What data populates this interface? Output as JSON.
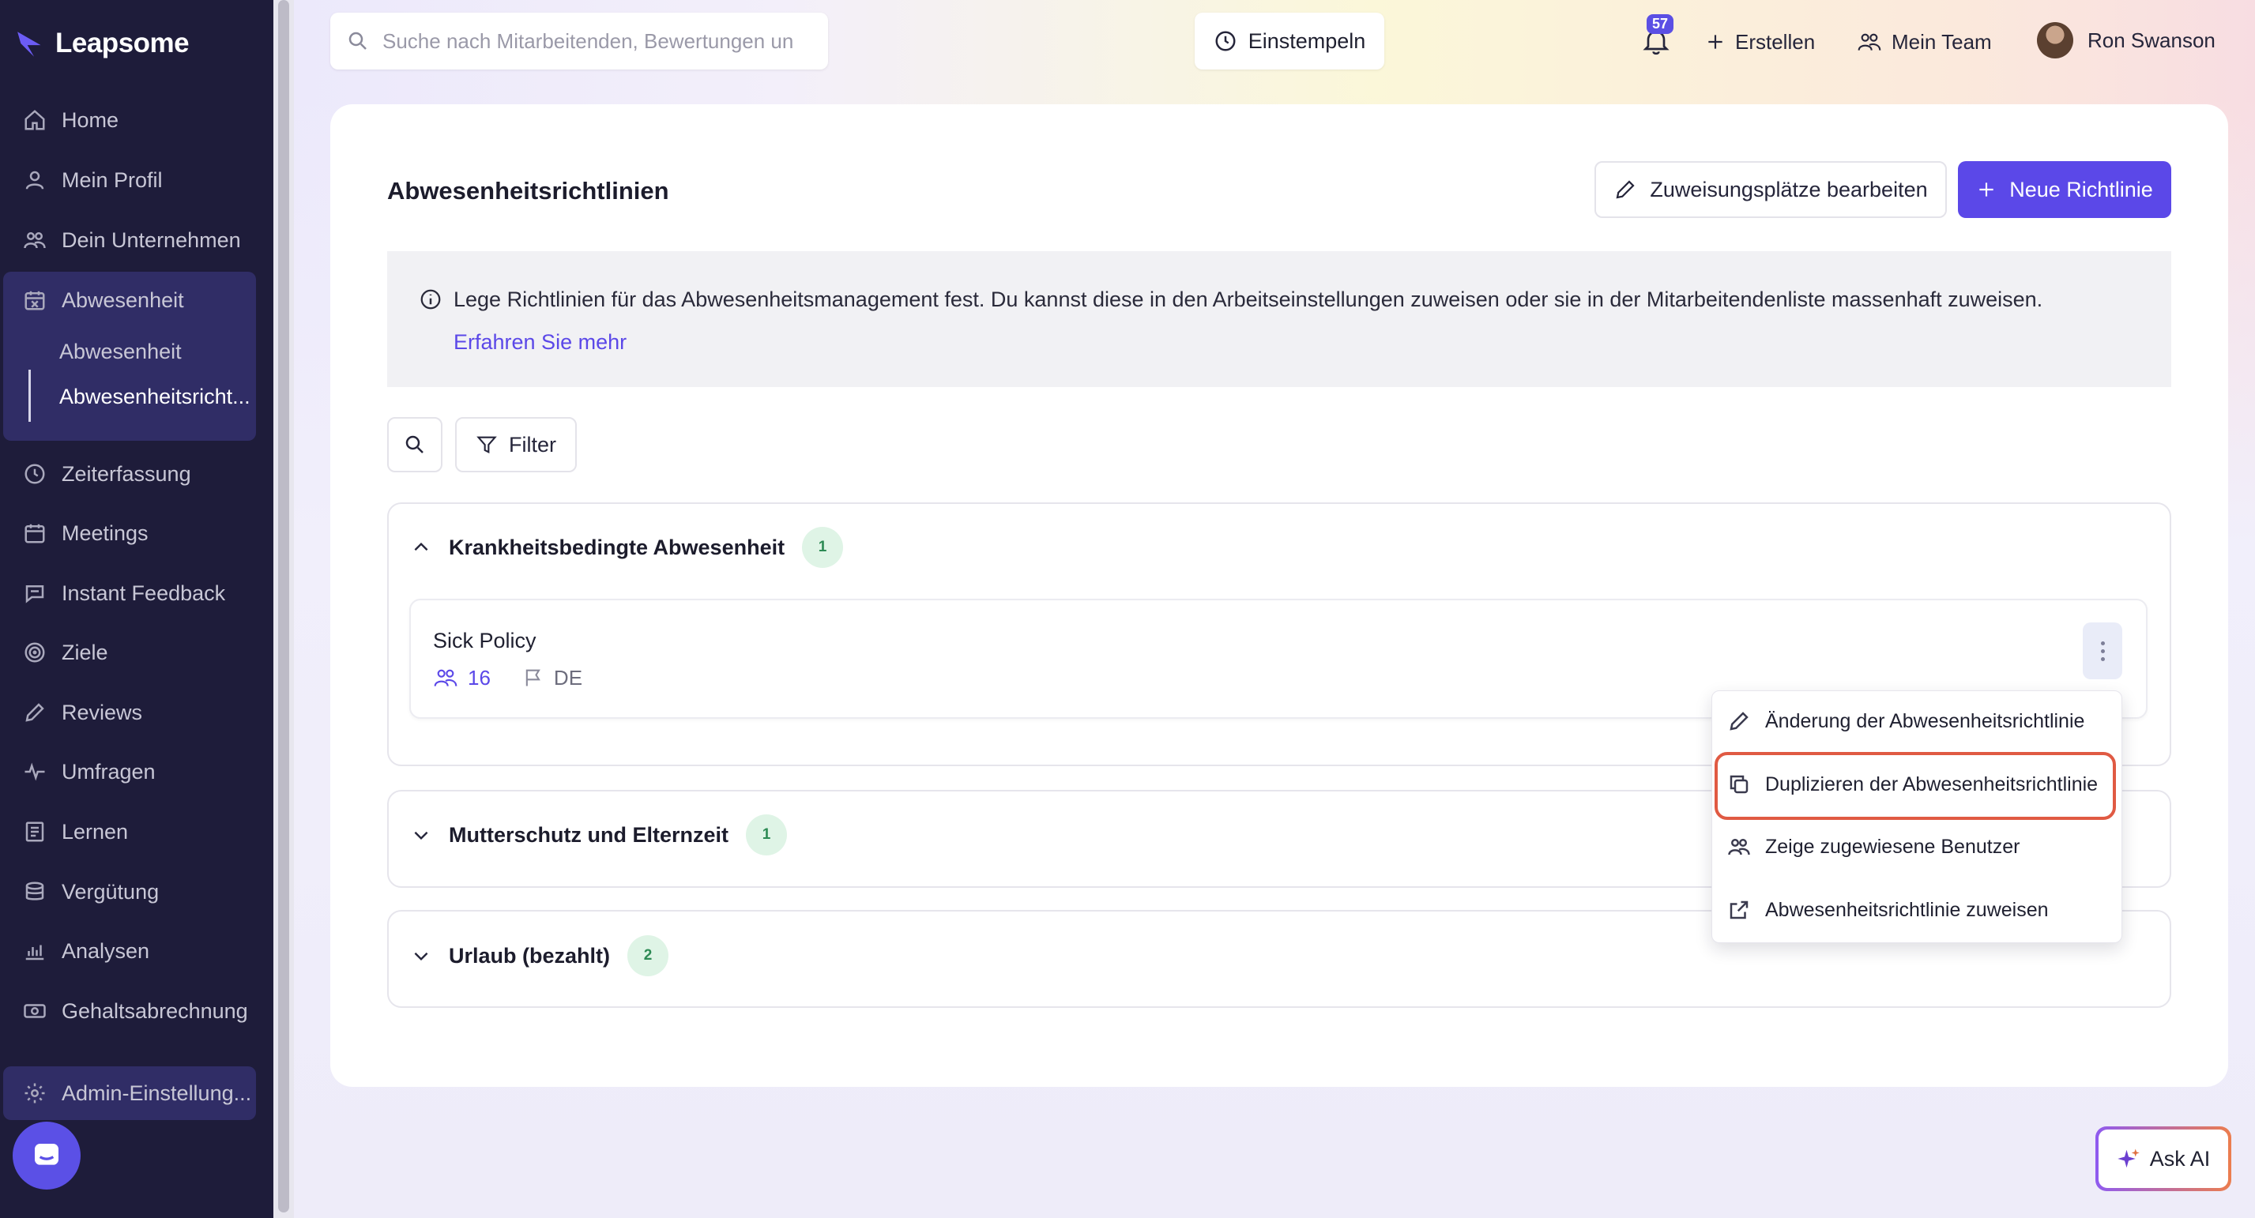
{
  "app": {
    "brand": "Leapsome"
  },
  "colors": {
    "accent": "#5b48e8",
    "sidebar": "#1e1c3a",
    "badge_green": "#dff4e6",
    "highlight": "#e05a43"
  },
  "sidebar": {
    "items": [
      {
        "label": "Home",
        "icon": "home-icon"
      },
      {
        "label": "Mein Profil",
        "icon": "user-icon"
      },
      {
        "label": "Dein Unternehmen",
        "icon": "users-icon"
      },
      {
        "label": "Abwesenheit",
        "icon": "calendar-x-icon"
      },
      {
        "label": "Zeiterfassung",
        "icon": "clock-icon"
      },
      {
        "label": "Meetings",
        "icon": "calendar-icon"
      },
      {
        "label": "Instant Feedback",
        "icon": "chat-icon"
      },
      {
        "label": "Ziele",
        "icon": "target-icon"
      },
      {
        "label": "Reviews",
        "icon": "pencil-icon"
      },
      {
        "label": "Umfragen",
        "icon": "pulse-icon"
      },
      {
        "label": "Lernen",
        "icon": "book-icon"
      },
      {
        "label": "Vergütung",
        "icon": "coins-icon"
      },
      {
        "label": "Analysen",
        "icon": "chart-icon"
      },
      {
        "label": "Gehaltsabrechnung",
        "icon": "money-icon"
      },
      {
        "label": "Admin-Einstellung...",
        "icon": "gear-icon"
      }
    ],
    "sub_items": [
      "Abwesenheit",
      "Abwesenheitsricht..."
    ]
  },
  "topbar": {
    "search_placeholder": "Suche nach Mitarbeitenden, Bewertungen un",
    "clock_in": "Einstempeln",
    "notification_count": "57",
    "create": "Erstellen",
    "my_team": "Mein Team",
    "user_name": "Ron Swanson"
  },
  "page": {
    "title": "Abwesenheitsrichtlinien",
    "edit_assignments": "Zuweisungsplätze bearbeiten",
    "new_policy": "Neue Richtlinie",
    "info_text": "Lege Richtlinien für das Abwesenheitsmanagement fest. Du kannst diese in den Arbeitseinstellungen zuweisen oder sie in der Mitarbeitendenliste massenhaft zuweisen.",
    "info_link": "Erfahren Sie mehr",
    "filter": "Filter"
  },
  "sections": [
    {
      "title": "Krankheitsbedingte Abwesenheit",
      "count": "1",
      "expanded": true
    },
    {
      "title": "Mutterschutz und Elternzeit",
      "count": "1",
      "expanded": false
    },
    {
      "title": "Urlaub (bezahlt)",
      "count": "2",
      "expanded": false
    }
  ],
  "policy": {
    "name": "Sick Policy",
    "users": "16",
    "country": "DE"
  },
  "menu": {
    "items": [
      "Änderung der Abwesenheitsrichtlinie",
      "Duplizieren der Abwesenheitsrichtlinie",
      "Zeige zugewiesene Benutzer",
      "Abwesenheitsrichtlinie zuweisen"
    ]
  },
  "ask_ai": "Ask AI"
}
